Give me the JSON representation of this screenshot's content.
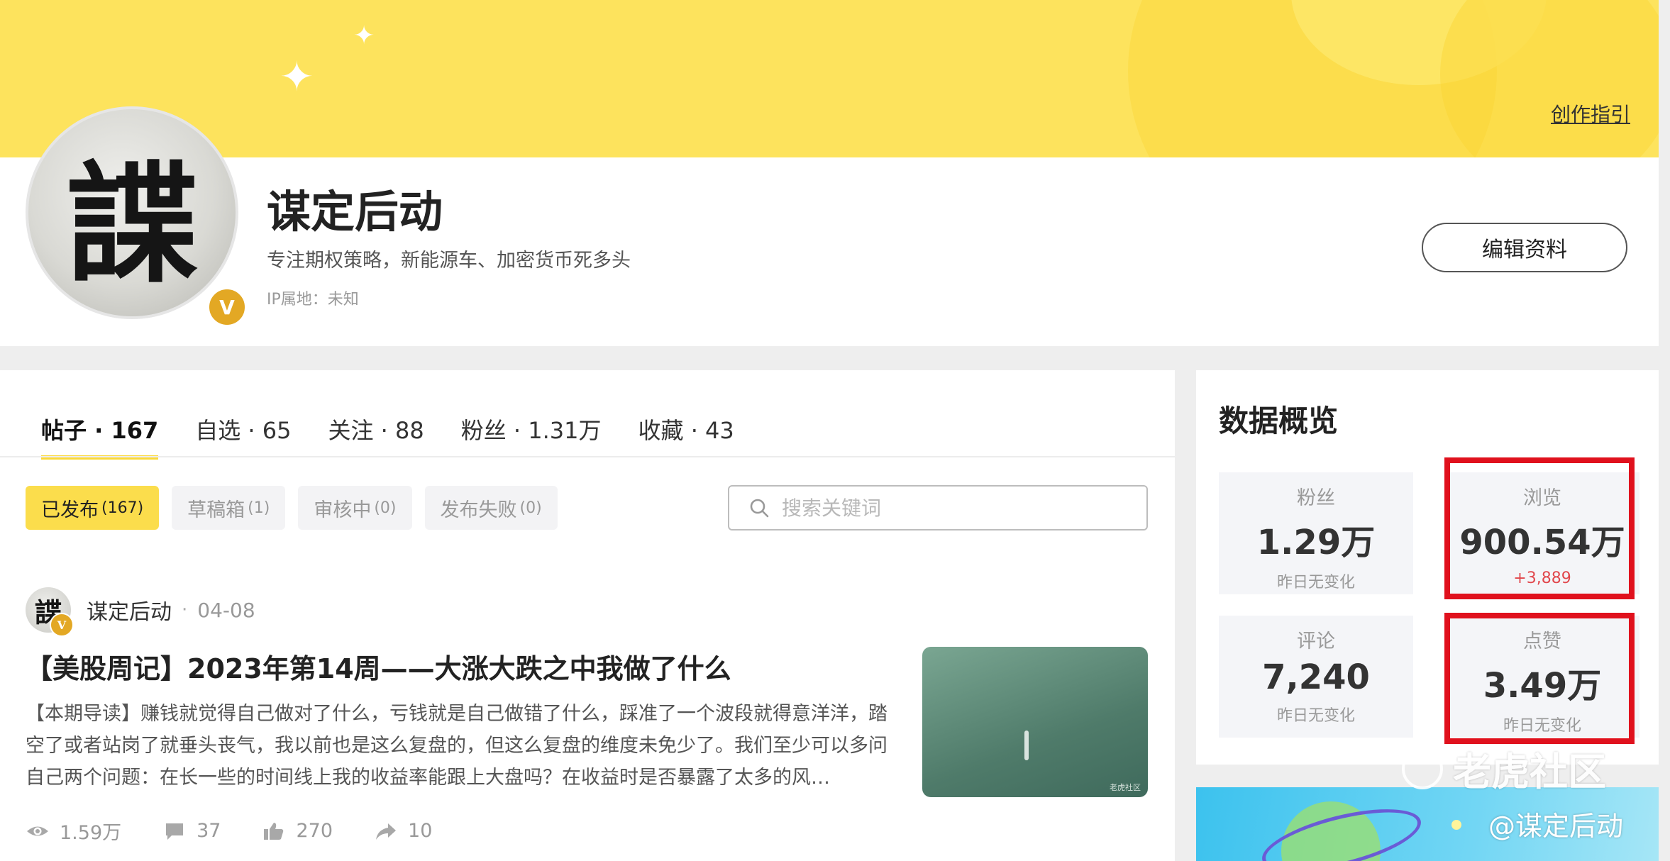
{
  "banner": {
    "guide_link": "创作指引"
  },
  "profile": {
    "avatar_glyph": "諜",
    "badge": "V",
    "name": "谋定后动",
    "bio": "专注期权策略，新能源车、加密货币死多头",
    "ip_location": "IP属地：未知",
    "edit_button": "编辑资料"
  },
  "tabs": [
    {
      "label": "帖子 · 167",
      "active": true
    },
    {
      "label": "自选 · 65",
      "active": false
    },
    {
      "label": "关注 · 88",
      "active": false
    },
    {
      "label": "粉丝 · 1.31万",
      "active": false
    },
    {
      "label": "收藏 · 43",
      "active": false
    }
  ],
  "filters": [
    {
      "label": "已发布",
      "count": "(167)",
      "active": true
    },
    {
      "label": "草稿箱",
      "count": "(1)",
      "active": false
    },
    {
      "label": "审核中",
      "count": "(0)",
      "active": false
    },
    {
      "label": "发布失败",
      "count": "(0)",
      "active": false
    }
  ],
  "search": {
    "placeholder": "搜索关键词"
  },
  "post": {
    "author": "谋定后动",
    "dot": "·",
    "date": "04-08",
    "title": "【美股周记】2023年第14周——大涨大跌之中我做了什么",
    "excerpt": "【本期导读】赚钱就觉得自己做对了什么，亏钱就是自己做错了什么，踩准了一个波段就得意洋洋，踏空了或者站岗了就垂头丧气，我以前也是这么复盘的，但这么复盘的维度未免少了。我们至少可以多问自己两个问题：在长一些的时间线上我的收益率能跟上大盘吗？在收益时是否暴露了太多的风…",
    "thumb_watermark": "老虎社区",
    "stats": {
      "views": "1.59万",
      "comments": "37",
      "likes": "270",
      "shares": "10"
    }
  },
  "overview": {
    "title": "数据概览",
    "metrics": {
      "fans": {
        "label": "粉丝",
        "value": "1.29万",
        "delta": "昨日无变化"
      },
      "views": {
        "label": "浏览",
        "value": "900.54万",
        "delta": "+3,889"
      },
      "comments": {
        "label": "评论",
        "value": "7,240",
        "delta": "昨日无变化"
      },
      "likes": {
        "label": "点赞",
        "value": "3.49万",
        "delta": "昨日无变化"
      }
    }
  },
  "watermark": {
    "brand": "老虎社区",
    "handle": "@谋定后动"
  },
  "colors": {
    "banner": "#fde35d",
    "accent": "#fbd938",
    "highlight": "#e0111d",
    "badge": "#e3a824",
    "positive_delta": "#e1484d"
  }
}
